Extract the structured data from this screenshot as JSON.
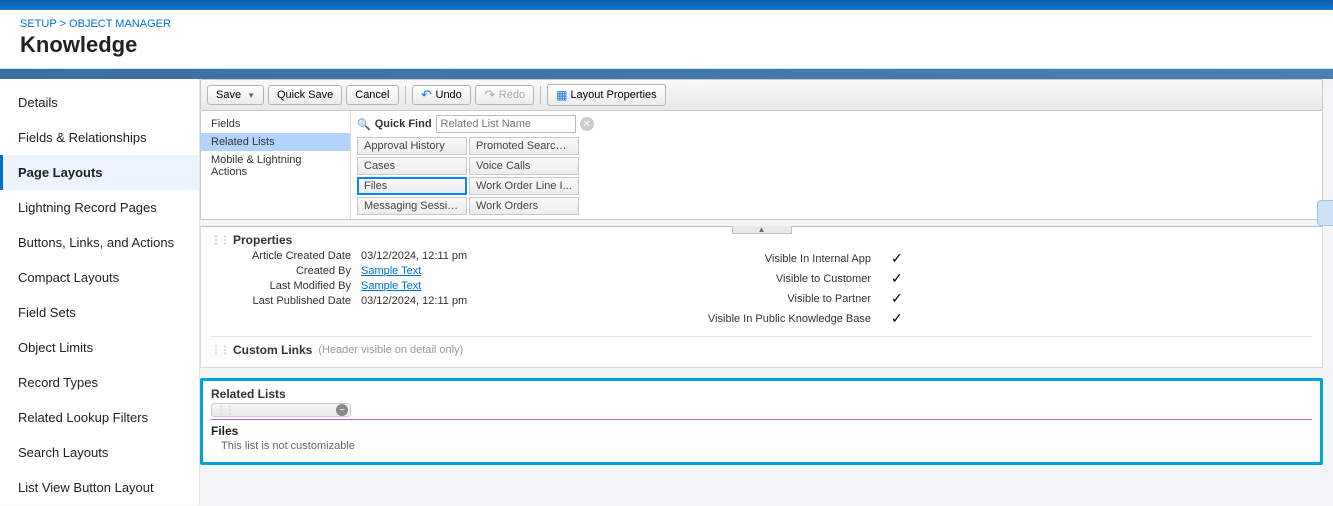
{
  "breadcrumb": {
    "setup": "SETUP",
    "sep": ">",
    "object_manager": "OBJECT MANAGER"
  },
  "page_title": "Knowledge",
  "sidebar": {
    "items": [
      {
        "label": "Details"
      },
      {
        "label": "Fields & Relationships"
      },
      {
        "label": "Page Layouts",
        "active": true
      },
      {
        "label": "Lightning Record Pages"
      },
      {
        "label": "Buttons, Links, and Actions"
      },
      {
        "label": "Compact Layouts"
      },
      {
        "label": "Field Sets"
      },
      {
        "label": "Object Limits"
      },
      {
        "label": "Record Types"
      },
      {
        "label": "Related Lookup Filters"
      },
      {
        "label": "Search Layouts"
      },
      {
        "label": "List View Button Layout"
      }
    ]
  },
  "toolbar": {
    "save": "Save",
    "quick_save": "Quick Save",
    "cancel": "Cancel",
    "undo": "Undo",
    "redo": "Redo",
    "layout_props": "Layout Properties"
  },
  "palette": {
    "categories": [
      {
        "label": "Fields"
      },
      {
        "label": "Related Lists",
        "selected": true
      },
      {
        "label": "Mobile & Lightning Actions"
      }
    ],
    "quick_find_label": "Quick Find",
    "quick_find_placeholder": "Related List Name",
    "chips_col1": [
      {
        "label": "Approval History"
      },
      {
        "label": "Cases"
      },
      {
        "label": "Files",
        "hot": true
      },
      {
        "label": "Messaging Sessions"
      }
    ],
    "chips_col2": [
      {
        "label": "Promoted Search T..."
      },
      {
        "label": "Voice Calls"
      },
      {
        "label": "Work Order Line I..."
      },
      {
        "label": "Work Orders"
      }
    ]
  },
  "sections": {
    "properties_title": "Properties",
    "custom_links_title": "Custom Links",
    "custom_links_note": "(Header visible on detail only)",
    "related_lists_title": "Related Lists"
  },
  "properties": {
    "left": [
      {
        "label": "Article Created Date",
        "value": "03/12/2024, 12:11 pm"
      },
      {
        "label": "Created By",
        "value": "Sample Text",
        "link": true
      },
      {
        "label": "Last Modified By",
        "value": "Sample Text",
        "link": true
      },
      {
        "label": "Last Published Date",
        "value": "03/12/2024, 12:11 pm"
      }
    ],
    "right": [
      {
        "label": "Visible In Internal App",
        "check": true
      },
      {
        "label": "Visible to Customer",
        "check": true
      },
      {
        "label": "Visible to Partner",
        "check": true
      },
      {
        "label": "Visible In Public Knowledge Base",
        "check": true
      }
    ]
  },
  "related_list_drop": {
    "title": "Files",
    "note": "This list is not customizable"
  }
}
